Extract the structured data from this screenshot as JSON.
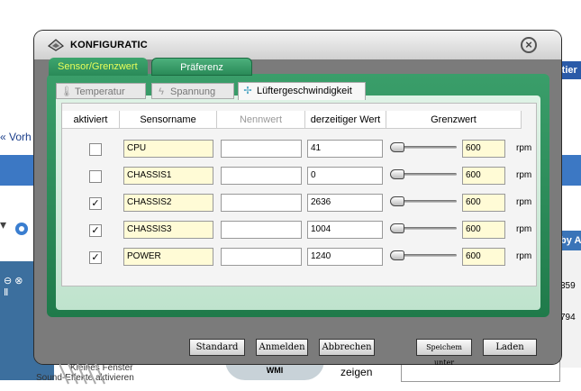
{
  "background": {
    "left_link": "« Vorh",
    "right_tab_text": "ftier",
    "right_tab2_text": "by A",
    "num1": "359",
    "num2": "794",
    "bottom_item1": "Kleines Fenster",
    "bottom_item2": "Sound-Effekte aktivieren",
    "bottom_anzeigen": "zeigen",
    "wmi_label": "WMI"
  },
  "dialog": {
    "title": "KONFIGURATIC",
    "close_icon": "close-circle-icon"
  },
  "main_tabs": [
    {
      "label": "Sensor/Grenzwert",
      "active": true
    },
    {
      "label": "Präferenz",
      "active": false
    }
  ],
  "sub_tabs": [
    {
      "label": "Temperatur",
      "icon": "thermometer-icon",
      "active": false
    },
    {
      "label": "Spannung",
      "icon": "voltage-icon",
      "active": false
    },
    {
      "label": "Lüftergeschwindigkeit",
      "icon": "fan-icon",
      "active": true
    }
  ],
  "table": {
    "headers": {
      "enabled": "aktiviert",
      "sensor": "Sensorname",
      "nominal": "Nennwert",
      "current": "derzeitiger Wert",
      "limit": "Grenzwert"
    },
    "rows": [
      {
        "checked": false,
        "name": "CPU",
        "nominal": "",
        "current": "41",
        "limit": "600",
        "unit": "rpm",
        "slider_level": 0
      },
      {
        "checked": false,
        "name": "CHASSIS1",
        "nominal": "",
        "current": "0",
        "limit": "600",
        "unit": "rpm",
        "slider_level": 0
      },
      {
        "checked": true,
        "name": "CHASSIS2",
        "nominal": "",
        "current": "2636",
        "limit": "600",
        "unit": "rpm",
        "slider_level": 0
      },
      {
        "checked": true,
        "name": "CHASSIS3",
        "nominal": "",
        "current": "1004",
        "limit": "600",
        "unit": "rpm",
        "slider_level": 0
      },
      {
        "checked": true,
        "name": "POWER",
        "nominal": "",
        "current": "1240",
        "limit": "600",
        "unit": "rpm",
        "slider_level": 0
      }
    ]
  },
  "buttons": {
    "standard": "Standard",
    "apply": "Anmelden",
    "cancel": "Abbrechen",
    "save_as": "Speichem unter",
    "load": "Laden"
  },
  "check_mark": "✓",
  "colors": {
    "panel_green": "#2a8a58",
    "active_tab_text": "#e8ff5a",
    "input_yellow": "#fffbd6"
  }
}
